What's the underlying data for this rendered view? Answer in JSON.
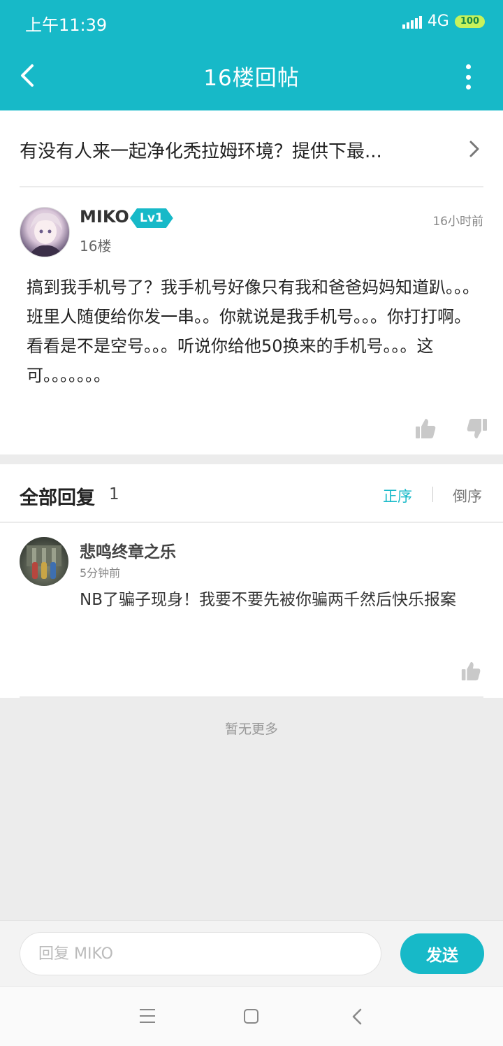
{
  "status_bar": {
    "time": "上午11:39",
    "network": "4G",
    "battery": "100"
  },
  "navbar": {
    "title": "16楼回帖"
  },
  "thread": {
    "title": "有没有人来一起净化秃拉姆环境？提供下最..."
  },
  "post": {
    "author": "MIKO",
    "level": "Lv1",
    "floor": "16楼",
    "time": "16小时前",
    "body": "搞到我手机号了？我手机号好像只有我和爸爸妈妈知道趴。。。班里人随便给你发一串。。你就说是我手机号。。。你打打啊。看看是不是空号。。。听说你给他50换来的手机号。。。这可。。。。。。。"
  },
  "replies": {
    "title": "全部回复",
    "count": "1",
    "sort_asc": "正序",
    "sort_desc": "倒序",
    "items": [
      {
        "author": "悲鸣终章之乐",
        "time": "5分钟前",
        "body": "NB了骗子现身！我要不要先被你骗两千然后快乐报案"
      }
    ],
    "no_more": "暂无更多"
  },
  "composer": {
    "placeholder": "回复 MIKO",
    "send_label": "发送"
  },
  "colors": {
    "accent": "#17b9c8",
    "battery": "#c7f25b",
    "background": "#ececec"
  }
}
